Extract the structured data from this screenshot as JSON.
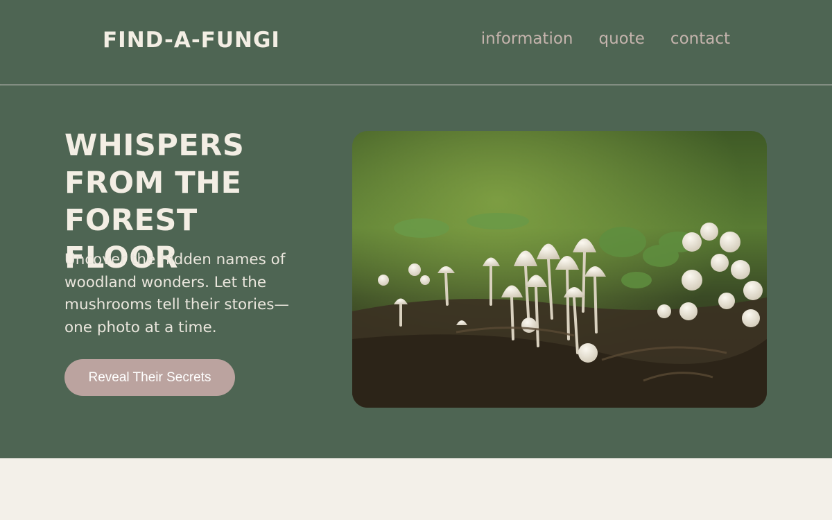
{
  "brand": {
    "logo_text": "FIND-A-FUNGI"
  },
  "nav": {
    "items": [
      {
        "label": "information"
      },
      {
        "label": "quote"
      },
      {
        "label": "contact"
      }
    ]
  },
  "hero": {
    "title": "Whispers from the Forest Floor",
    "description": "Uncover the hidden names of woodland wonders. Let the mushrooms tell their stories—one photo at a time.",
    "cta_label": "Reveal Their Secrets",
    "image_subject": "mushrooms-on-forest-floor"
  },
  "colors": {
    "primary_green": "#4e6553",
    "cream": "#f3eee4",
    "nav_text": "#c5b4ad",
    "button": "#bba39f",
    "footer_bg": "#f3f0e9"
  }
}
